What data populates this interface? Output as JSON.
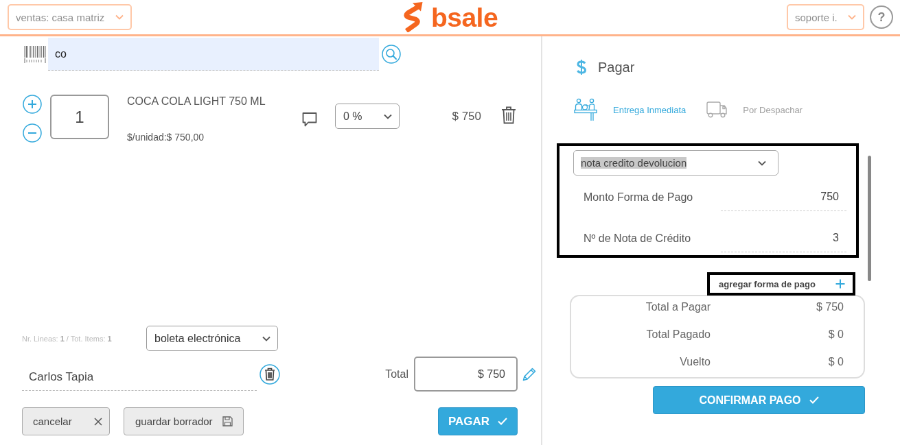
{
  "header": {
    "branch_select": {
      "value": "ventas: casa matriz"
    },
    "logo": {
      "text": "bsale"
    },
    "user_select": {
      "value": "soporte i."
    },
    "help_button": {
      "label": "?"
    }
  },
  "search": {
    "value": "co"
  },
  "cart_items": [
    {
      "quantity": "1",
      "name": "COCA COLA LIGHT 750 ML",
      "unit_price": "$/unidad:$ 750,00",
      "discount": "0 %",
      "subtotal": "$ 750"
    }
  ],
  "cart_summary": "Nr. Lineas: **1** / Tot. Items: **1**",
  "document_type": {
    "value": "boleta electrónica"
  },
  "customer": {
    "value": "Carlos Tapia"
  },
  "total": {
    "label": "Total",
    "value": "$ 750"
  },
  "actions": [
    {
      "label": "cancelar",
      "kind": "cancel"
    },
    {
      "label": "guardar borrador",
      "kind": "draft"
    },
    {
      "label": "PAGAR",
      "kind": "pay"
    }
  ],
  "payment": {
    "title": "Pagar",
    "delivery_options": [
      {
        "label": "Entrega Inmediata",
        "kind": "pickup",
        "selected": true
      },
      {
        "label": "Por Despachar",
        "kind": "dispatch",
        "selected": false
      }
    ],
    "method_panel": {
      "highlighted": true,
      "method": {
        "value": "nota credito devolucion",
        "text_selected": true
      },
      "fields": [
        {
          "label": "Monto Forma de Pago",
          "value": "750"
        },
        {
          "label": "Nº de Nota de Crédito",
          "value": "3"
        }
      ]
    },
    "add_method_button": {
      "label": "agregar forma de pago",
      "highlighted": true
    },
    "totals": [
      {
        "label": "Total a Pagar",
        "value": "$ 750"
      },
      {
        "label": "Total Pagado",
        "value": "$ 0"
      },
      {
        "label": "Vuelto",
        "value": "$ 0"
      }
    ],
    "confirm_button": {
      "label": "CONFIRMAR PAGO"
    }
  }
}
